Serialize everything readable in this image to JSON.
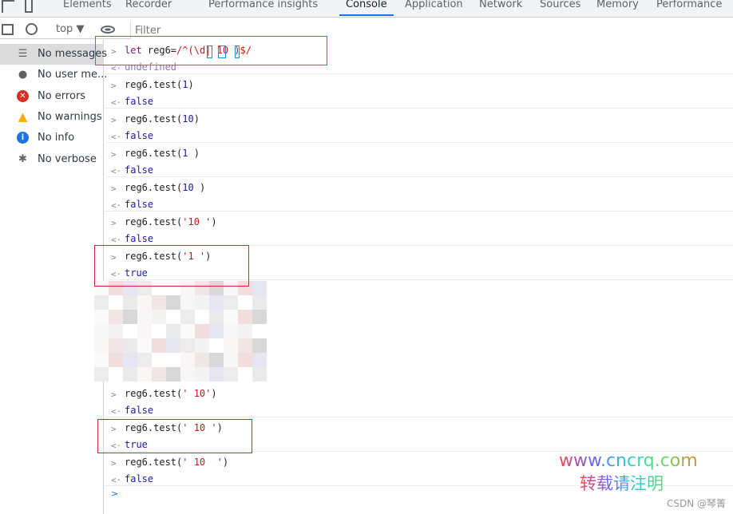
{
  "tabs": [
    {
      "label": "Elements"
    },
    {
      "label": "Recorder"
    },
    {
      "label": "Performance insights"
    },
    {
      "label": "Console",
      "active": true
    },
    {
      "label": "Application"
    },
    {
      "label": "Network"
    },
    {
      "label": "Sources"
    },
    {
      "label": "Memory"
    },
    {
      "label": "Performance"
    }
  ],
  "toolbar": {
    "context": "top",
    "filter_placeholder": "Filter"
  },
  "sidebar": {
    "items": [
      {
        "label": "No messages",
        "icon": "list-icon"
      },
      {
        "label": "No user me...",
        "icon": "user-icon"
      },
      {
        "label": "No errors",
        "icon": "error-icon",
        "color": "#d93025"
      },
      {
        "label": "No warnings",
        "icon": "warning-icon",
        "color": "#f9ab00"
      },
      {
        "label": "No info",
        "icon": "info-icon",
        "color": "#1a73e8"
      },
      {
        "label": "No verbose",
        "icon": "bug-icon"
      }
    ]
  },
  "console": {
    "first": {
      "input": "let reg6=/^(\\d| 10 )$/",
      "output": "undefined"
    },
    "entries": [
      {
        "fn": "reg6.test(",
        "arg": "1",
        "type": "num",
        "output": "false"
      },
      {
        "fn": "reg6.test(",
        "arg": "10",
        "type": "num",
        "output": "false"
      },
      {
        "fn": "reg6.test(",
        "arg": "1 ",
        "type": "num",
        "output": "false"
      },
      {
        "fn": "reg6.test(",
        "arg": "10 ",
        "type": "num",
        "output": "false"
      },
      {
        "fn": "reg6.test(",
        "arg": "'10 '",
        "type": "str",
        "output": "false"
      },
      {
        "fn": "reg6.test(",
        "arg": "'1 '",
        "type": "str",
        "output": "true"
      },
      {
        "fn": "reg6.test(",
        "arg": "' 10'",
        "type": "str",
        "output": "false"
      },
      {
        "fn": "reg6.test(",
        "arg": "' 10 '",
        "type": "str",
        "output": "true"
      },
      {
        "fn": "reg6.test(",
        "arg": "' 10  '",
        "type": "str",
        "output": "false"
      }
    ]
  },
  "watermark": {
    "line1": "www.cncrq.com",
    "line2": "转载请注明",
    "credit": "CSDN @琴箐"
  },
  "colors": {
    "accent": "#1a73e8",
    "highlight_blue": "#1a8fd6",
    "highlight_red": "#e0202a"
  }
}
